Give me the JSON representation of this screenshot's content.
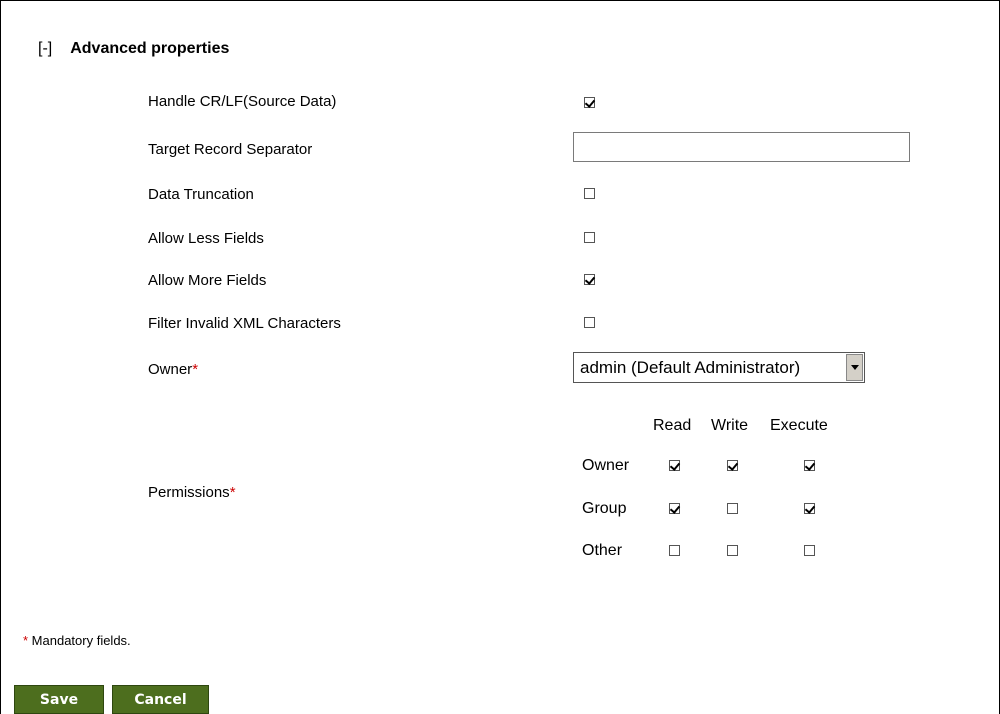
{
  "section": {
    "toggle": "[-]",
    "title": "Advanced properties"
  },
  "fields": {
    "handle_crlf": {
      "label": "Handle CR/LF(Source Data)",
      "checked": true
    },
    "target_record_separator": {
      "label": "Target Record Separator",
      "value": ""
    },
    "data_truncation": {
      "label": "Data Truncation",
      "checked": false
    },
    "allow_less_fields": {
      "label": "Allow Less Fields",
      "checked": false
    },
    "allow_more_fields": {
      "label": "Allow More Fields",
      "checked": true
    },
    "filter_invalid_xml": {
      "label": "Filter Invalid XML Characters",
      "checked": false
    },
    "owner": {
      "label": "Owner",
      "required_mark": "*",
      "selected": "admin (Default Administrator)"
    },
    "permissions": {
      "label": "Permissions",
      "required_mark": "*",
      "columns": [
        "Read",
        "Write",
        "Execute"
      ],
      "rows": [
        {
          "name": "Owner",
          "values": [
            true,
            true,
            true
          ]
        },
        {
          "name": "Group",
          "values": [
            true,
            false,
            true
          ]
        },
        {
          "name": "Other",
          "values": [
            false,
            false,
            false
          ]
        }
      ]
    }
  },
  "footer": {
    "required_mark": "*",
    "mandatory_note": " Mandatory fields."
  },
  "buttons": {
    "save": "Save",
    "cancel": "Cancel"
  },
  "colors": {
    "button_bg": "#4d6e1e",
    "required": "#cc0000"
  }
}
